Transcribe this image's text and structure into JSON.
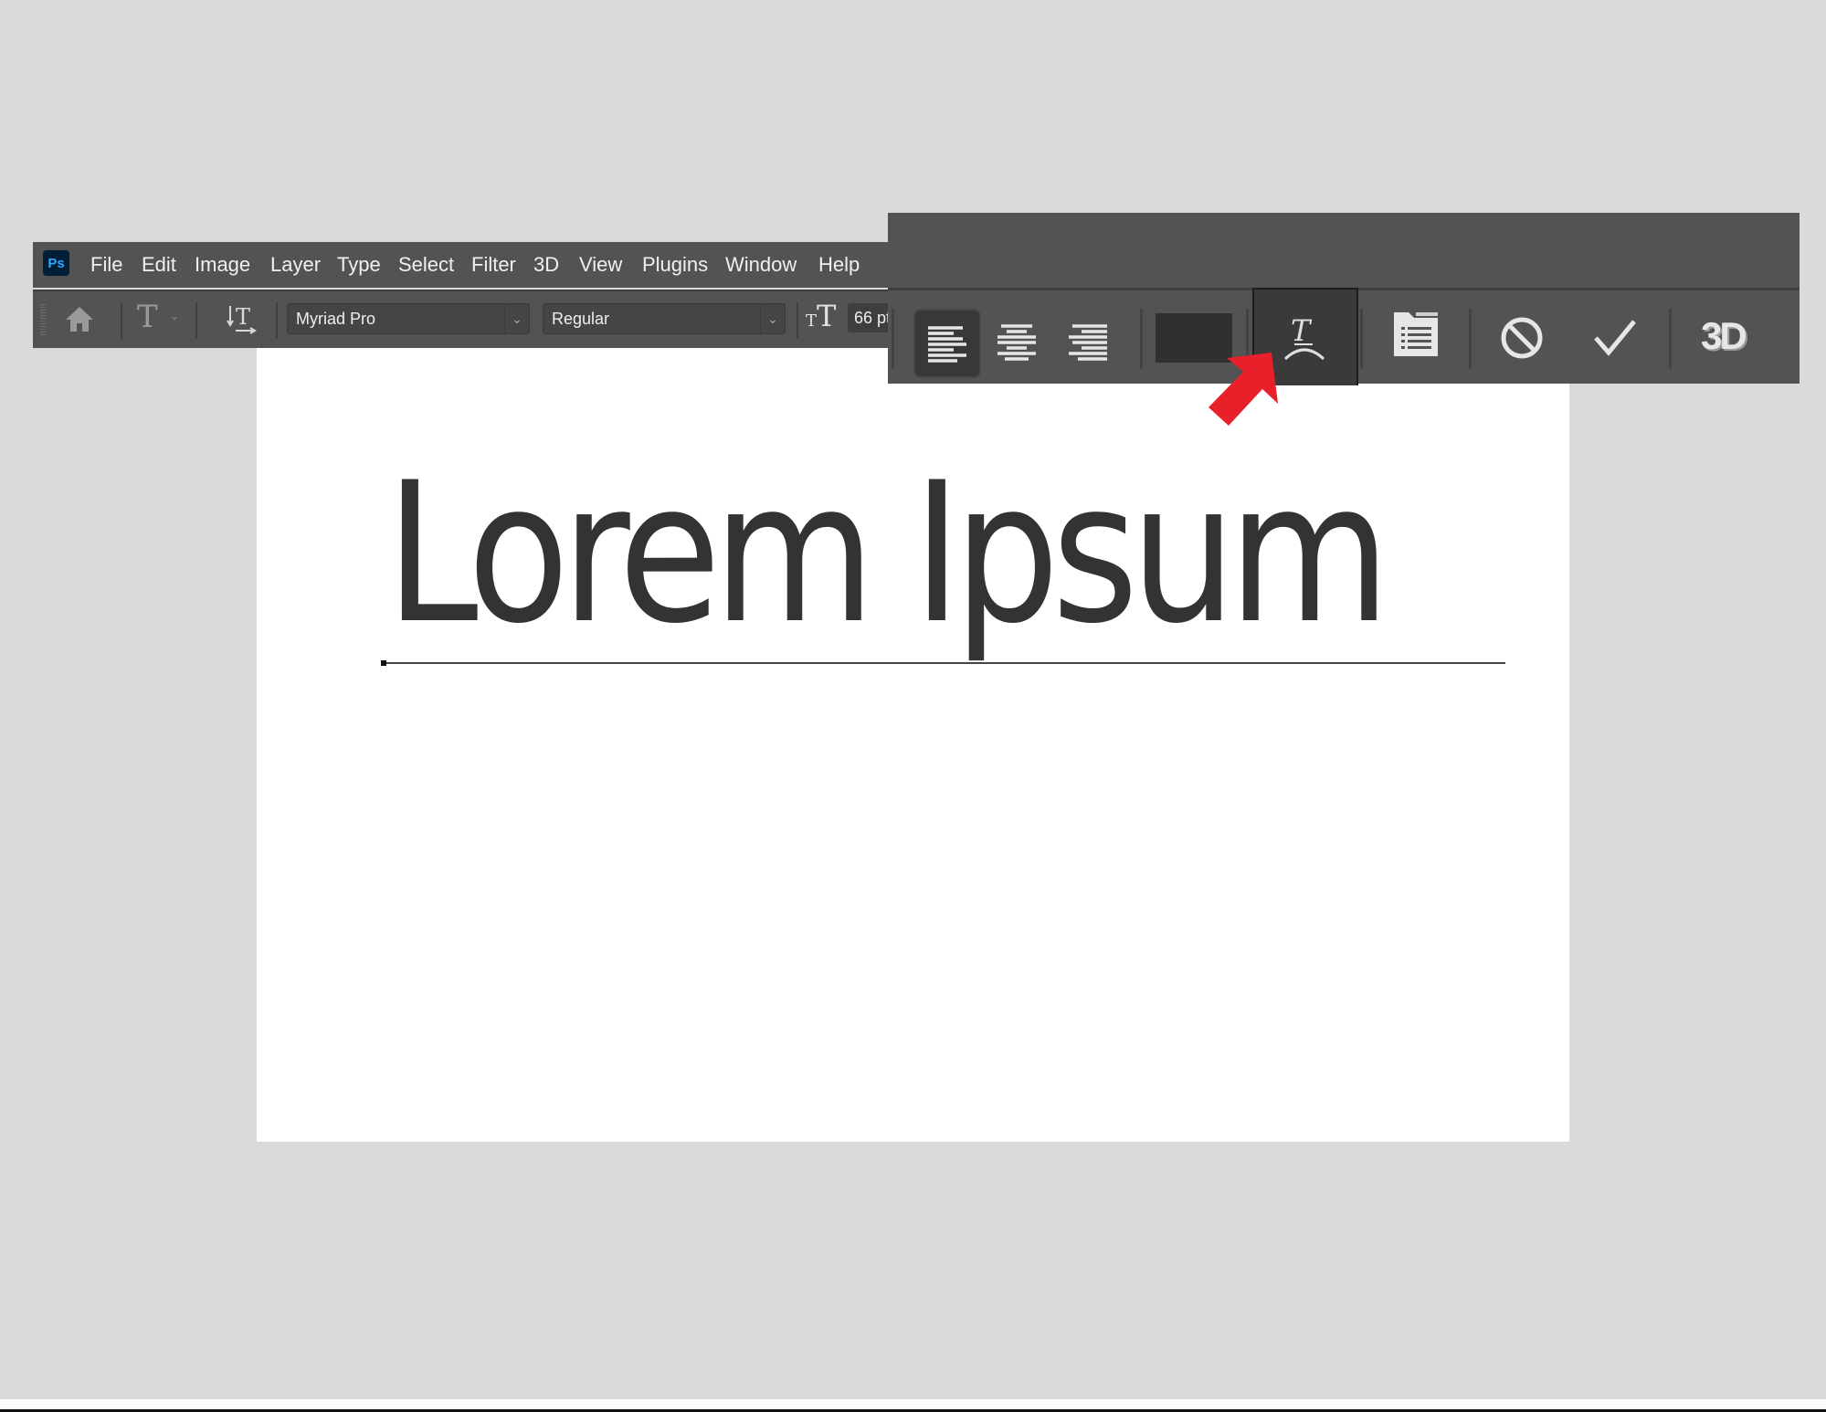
{
  "app": {
    "logo_text": "Ps"
  },
  "menu": [
    "File",
    "Edit",
    "Image",
    "Layer",
    "Type",
    "Select",
    "Filter",
    "3D",
    "View",
    "Plugins",
    "Window",
    "Help"
  ],
  "options_bar": {
    "font_family": "Myriad Pro",
    "font_style": "Regular",
    "font_size": "66 pt",
    "icons": [
      "home-icon",
      "type-tool-icon",
      "text-orientation-icon",
      "font-size-icon"
    ]
  },
  "enlarged_options": {
    "alignment": [
      "left",
      "center",
      "right"
    ],
    "active_alignment": "left",
    "text_color": "#303030",
    "highlighted_tool": "create-warped-text",
    "buttons": [
      "align-left",
      "align-center",
      "align-right",
      "text-color",
      "warp-text",
      "character-paragraph-panels",
      "cancel",
      "commit",
      "3d"
    ],
    "three_d_label": "3D"
  },
  "canvas": {
    "text": "Lorem Ipsum",
    "text_color": "#333333"
  },
  "annotation": {
    "arrow_color": "#e8202a",
    "points_to": "warp-text-button"
  },
  "colors": {
    "panel_bg": "#535353",
    "workspace_bg": "#dadada",
    "canvas_bg": "#ffffff"
  }
}
